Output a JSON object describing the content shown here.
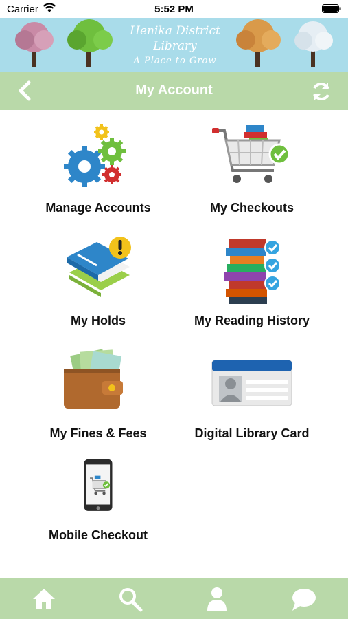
{
  "status_bar": {
    "carrier": "Carrier",
    "time": "5:52 PM"
  },
  "banner": {
    "library_name": "Henika District Library",
    "tagline": "A Place to Grow"
  },
  "nav": {
    "title": "My Account",
    "back_icon": "chevron-left-icon",
    "refresh_icon": "refresh-icon"
  },
  "menu": {
    "items": [
      {
        "label": "Manage Accounts",
        "icon": "gears-icon"
      },
      {
        "label": "My Checkouts",
        "icon": "shopping-cart-icon"
      },
      {
        "label": "My Holds",
        "icon": "book-alert-icon"
      },
      {
        "label": "My Reading History",
        "icon": "book-stack-icon"
      },
      {
        "label": "My Fines & Fees",
        "icon": "wallet-icon"
      },
      {
        "label": "Digital Library Card",
        "icon": "id-card-icon"
      },
      {
        "label": "Mobile Checkout",
        "icon": "mobile-phone-icon"
      }
    ]
  },
  "tab_bar": {
    "tabs": [
      {
        "name": "home",
        "icon": "home-icon"
      },
      {
        "name": "search",
        "icon": "search-icon"
      },
      {
        "name": "account",
        "icon": "person-icon"
      },
      {
        "name": "chat",
        "icon": "chat-bubble-icon"
      }
    ]
  },
  "colors": {
    "banner_bg": "#a9dcea",
    "nav_bg": "#b9d9a9",
    "tab_bg": "#b9d9a9"
  }
}
